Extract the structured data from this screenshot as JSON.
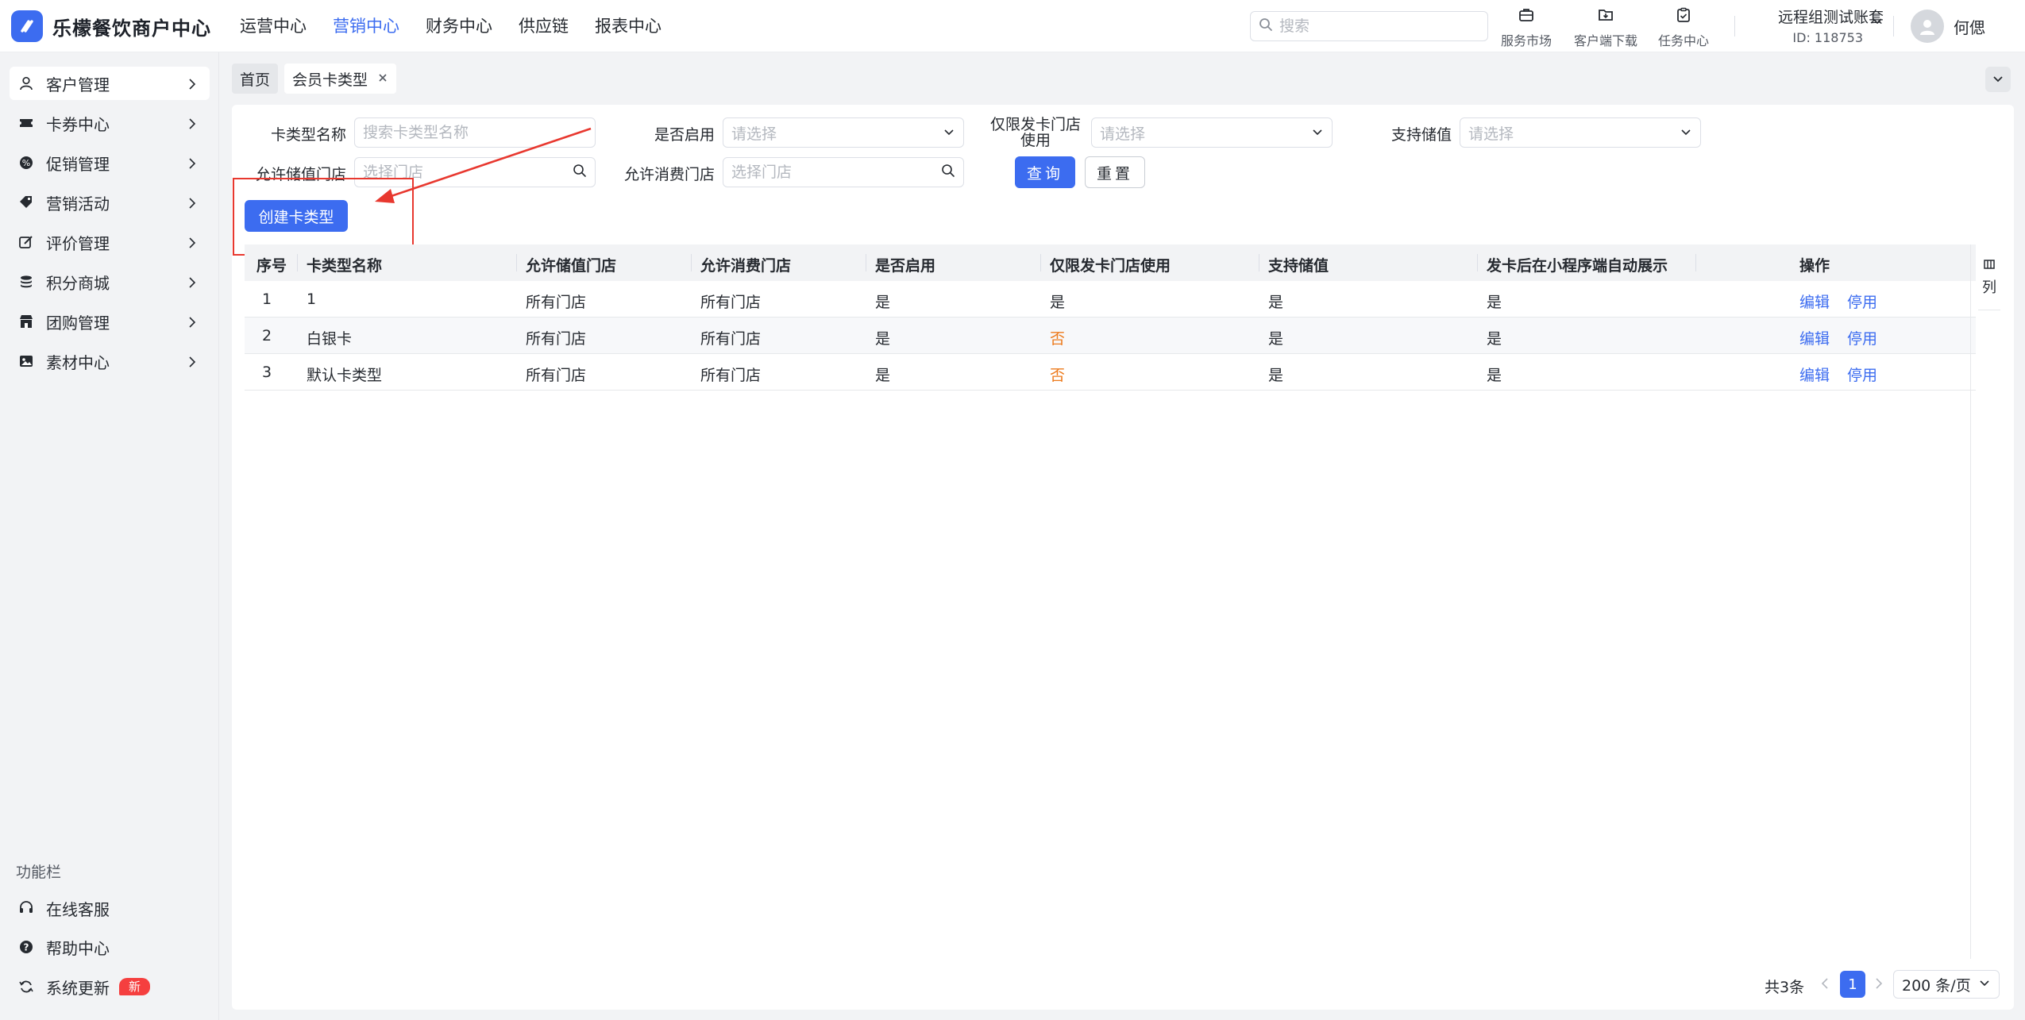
{
  "app": {
    "title": "乐檬餐饮商户中心"
  },
  "topnav": {
    "items": [
      {
        "label": "运营中心",
        "active": false
      },
      {
        "label": "营销中心",
        "active": true
      },
      {
        "label": "财务中心",
        "active": false
      },
      {
        "label": "供应链",
        "active": false
      },
      {
        "label": "报表中心",
        "active": false
      }
    ]
  },
  "search": {
    "placeholder": "搜索"
  },
  "tools": [
    {
      "label": "服务市场",
      "icon": "briefcase-icon"
    },
    {
      "label": "客户端下载",
      "icon": "folder-download-icon"
    },
    {
      "label": "任务中心",
      "icon": "clipboard-icon"
    }
  ],
  "account": {
    "name": "远程组测试账套",
    "id": "ID: 118753"
  },
  "user": {
    "name": "何偲"
  },
  "sidebar": {
    "items": [
      {
        "label": "客户管理",
        "icon": "user-icon",
        "active": true
      },
      {
        "label": "卡券中心",
        "icon": "ticket-icon",
        "active": false
      },
      {
        "label": "促销管理",
        "icon": "discount-icon",
        "active": false
      },
      {
        "label": "营销活动",
        "icon": "tag-icon",
        "active": false
      },
      {
        "label": "评价管理",
        "icon": "edit-review-icon",
        "active": false
      },
      {
        "label": "积分商城",
        "icon": "coins-icon",
        "active": false
      },
      {
        "label": "团购管理",
        "icon": "store-icon",
        "active": false
      },
      {
        "label": "素材中心",
        "icon": "image-icon",
        "active": false
      }
    ],
    "func_title": "功能栏",
    "func_items": [
      {
        "label": "在线客服",
        "icon": "headset-icon"
      },
      {
        "label": "帮助中心",
        "icon": "help-icon"
      },
      {
        "label": "系统更新",
        "icon": "refresh-icon",
        "badge": "新"
      }
    ]
  },
  "tabs": [
    {
      "label": "首页",
      "closable": false,
      "active": false
    },
    {
      "label": "会员卡类型",
      "closable": true,
      "active": true
    }
  ],
  "filters": {
    "card_type_name": {
      "label": "卡类型名称",
      "placeholder": "搜索卡类型名称"
    },
    "enabled": {
      "label": "是否启用",
      "placeholder": "请选择"
    },
    "issuing_store_only": {
      "label": "仅限发卡门店使用",
      "placeholder": "请选择"
    },
    "support_stored_value": {
      "label": "支持储值",
      "placeholder": "请选择"
    },
    "stored_value_store": {
      "label": "允许储值门店",
      "placeholder": "选择门店"
    },
    "consume_store": {
      "label": "允许消费门店",
      "placeholder": "选择门店"
    },
    "query_label": "查询",
    "reset_label": "重置"
  },
  "create_button": {
    "label": "创建卡类型"
  },
  "table": {
    "columns": [
      "序号",
      "卡类型名称",
      "允许储值门店",
      "允许消费门店",
      "是否启用",
      "仅限发卡门店使用",
      "支持储值",
      "发卡后在小程序端自动展示",
      "操作"
    ],
    "rows": [
      {
        "index": "1",
        "name": "1",
        "stored_store": "所有门店",
        "consume_store": "所有门店",
        "enabled": "是",
        "issuing_only": "是",
        "stored_value": "是",
        "auto_show": "是",
        "edit": "编辑",
        "disable": "停用"
      },
      {
        "index": "2",
        "name": "白银卡",
        "stored_store": "所有门店",
        "consume_store": "所有门店",
        "enabled": "是",
        "issuing_only": "否",
        "stored_value": "是",
        "auto_show": "是",
        "edit": "编辑",
        "disable": "停用"
      },
      {
        "index": "3",
        "name": "默认卡类型",
        "stored_store": "所有门店",
        "consume_store": "所有门店",
        "enabled": "是",
        "issuing_only": "否",
        "stored_value": "是",
        "auto_show": "是",
        "edit": "编辑",
        "disable": "停用"
      }
    ],
    "column_setting_label": "列"
  },
  "pagination": {
    "total": "共3条",
    "current_page": "1",
    "page_size": "200 条/页"
  },
  "colors": {
    "primary": "#3c6cf0",
    "warning": "#ed7a1c",
    "annotation": "#e8382f",
    "badge": "#f53f3f"
  }
}
